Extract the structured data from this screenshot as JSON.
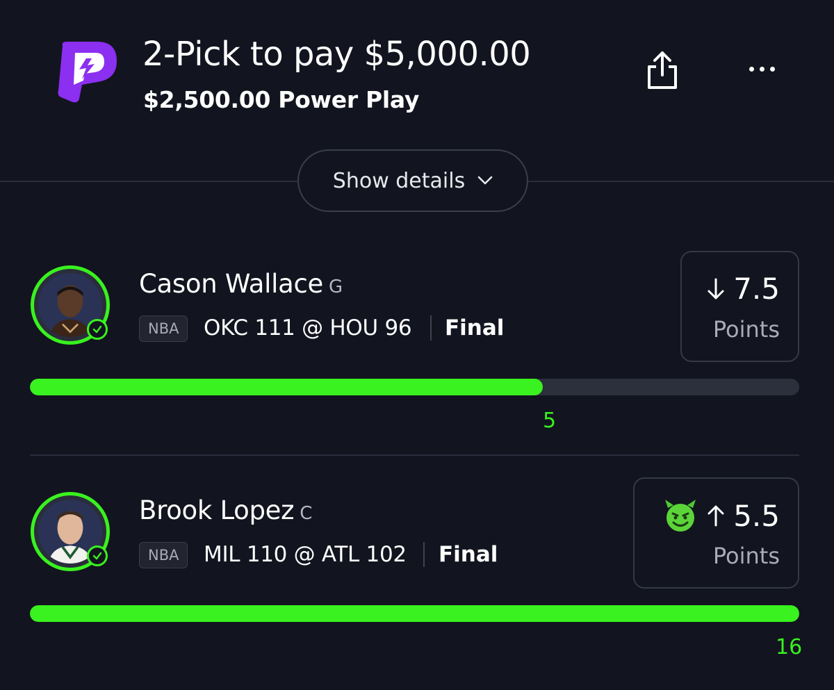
{
  "header": {
    "title": "2-Pick to pay $5,000.00",
    "subtitle": "$2,500.00 Power Play",
    "logo_icon": "prizepicks-logo-icon",
    "share_icon": "share-icon",
    "more_icon": "more-dots-icon"
  },
  "details_toggle": {
    "label": "Show details",
    "icon": "chevron-down-icon"
  },
  "colors": {
    "background": "#12141f",
    "accent_green": "#39f21f",
    "brand_purple": "#8a2be2"
  },
  "picks": [
    {
      "player": "Cason Wallace",
      "position": "G",
      "league": "NBA",
      "matchup": "OKC 111 @ HOU 96",
      "status": "Final",
      "direction_icon": "arrow-down-icon",
      "line": "7.5",
      "stat": "Points",
      "actual": "5",
      "progress_fraction": 0.667,
      "demon": false
    },
    {
      "player": "Brook Lopez",
      "position": "C",
      "league": "NBA",
      "matchup": "MIL 110 @ ATL 102",
      "status": "Final",
      "direction_icon": "arrow-up-icon",
      "line": "5.5",
      "stat": "Points",
      "actual": "16",
      "progress_fraction": 1.0,
      "demon": true
    }
  ]
}
